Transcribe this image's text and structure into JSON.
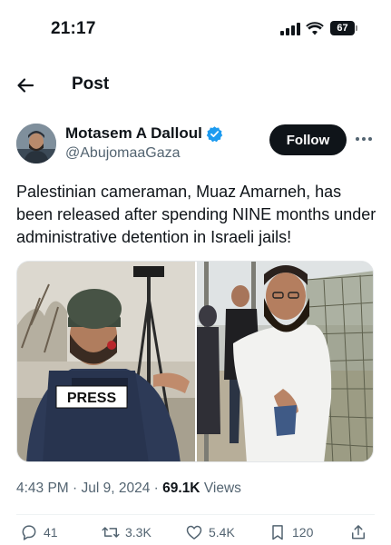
{
  "status_bar": {
    "time": "21:17",
    "battery": "67"
  },
  "header": {
    "title": "Post"
  },
  "author": {
    "name": "Motasem A Dalloul",
    "handle": "@AbujomaaGaza",
    "follow_label": "Follow"
  },
  "post": {
    "text": "Palestinian cameraman, Muaz Amarneh, has been released after spending NINE months under administrative detention in Israeli jails!",
    "press_label": "PRESS"
  },
  "meta": {
    "time": "4:43 PM",
    "separator": " · ",
    "date": "Jul 9, 2024",
    "views_count": "69.1K",
    "views_label": "Views"
  },
  "actions": {
    "replies": "41",
    "reposts": "3.3K",
    "likes": "5.4K",
    "bookmarks": "120"
  },
  "colors": {
    "text_primary": "#0f1419",
    "text_secondary": "#536471",
    "verified": "#1d9bf0",
    "follow_bg": "#0f1419"
  }
}
